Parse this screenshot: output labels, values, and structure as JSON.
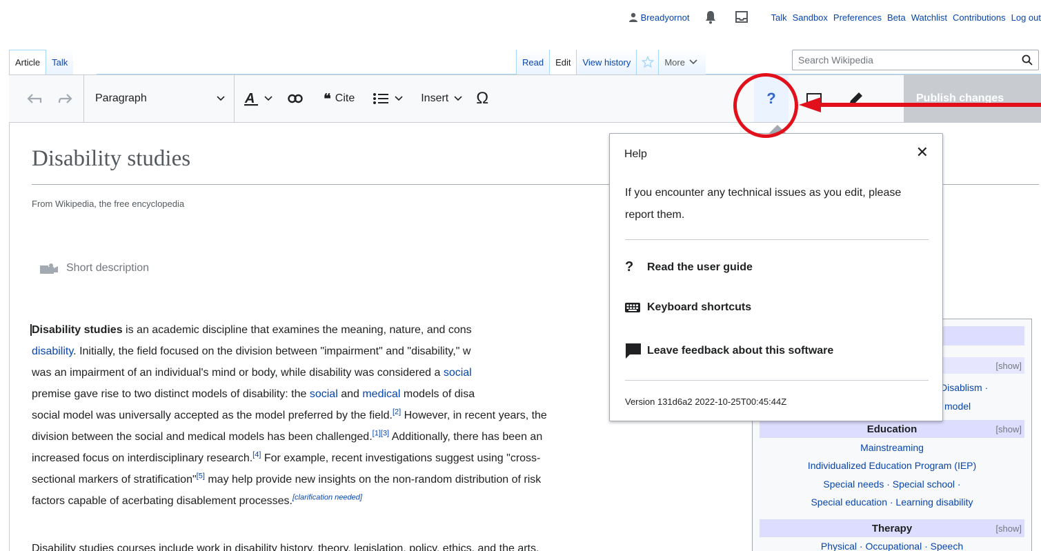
{
  "personal": {
    "username": "Breadyornot",
    "links": [
      "Talk",
      "Sandbox",
      "Preferences",
      "Beta",
      "Watchlist",
      "Contributions",
      "Log out"
    ],
    "icons": [
      "user-icon",
      "bell-icon",
      "tray-icon"
    ]
  },
  "tabs": {
    "article": "Article",
    "talk": "Talk",
    "read": "Read",
    "edit": "Edit",
    "history": "View history",
    "more": "More"
  },
  "search": {
    "placeholder": "Search Wikipedia"
  },
  "toolbar": {
    "format": "Paragraph",
    "cite": "Cite",
    "insert": "Insert",
    "help": "?",
    "publish": "Publish changes"
  },
  "article": {
    "title": "Disability studies",
    "tagline": "From Wikipedia, the free encyclopedia",
    "short_description": "Short description",
    "para2": "Disability studies courses include work in disability history, theory, legislation, policy, ethics, and the arts."
  },
  "infobox": {
    "row1_show": "[show]",
    "frag_disablism": "Disablism ·",
    "frag_model": "model",
    "education_head": "Education",
    "education_show": "[show]",
    "education_items": [
      "Mainstreaming",
      "Individualized Education Program (IEP)",
      "Special needs · Special school ·",
      "Special education · Learning disability"
    ],
    "therapy_head": "Therapy",
    "therapy_show": "[show]",
    "therapy_item": "Physical · Occupational · Speech"
  },
  "help": {
    "title": "Help",
    "message": "If you encounter any technical issues as you edit, please report them.",
    "items": [
      "Read the user guide",
      "Keyboard shortcuts",
      "Leave feedback about this software"
    ],
    "version": "Version 131d6a2 2022-10-25T00:45:44Z"
  },
  "colors": {
    "link": "#0645ad",
    "annotation": "#e2101b",
    "infobox_head": "#ddddff"
  }
}
